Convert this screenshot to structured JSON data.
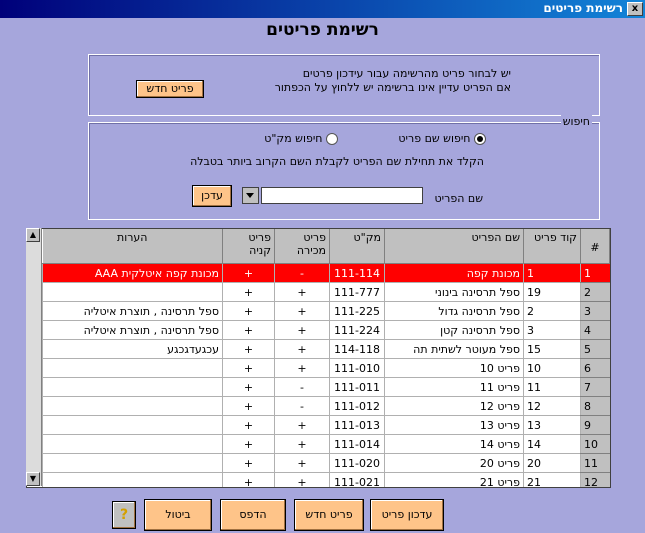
{
  "window": {
    "title": "רשימת פריטים",
    "close_glyph": "x"
  },
  "heading": "רשימת פריטים",
  "info": {
    "line1": "יש לבחור פריט מהרשימה עבור עידכון פרטים",
    "line2": "אם הפריט עדיין אינו ברשימה יש ללחוץ על הכפתור",
    "new_item_button": "פריט חדש"
  },
  "search": {
    "legend": "חיפוש",
    "option_name": "חיפוש שם פריט",
    "option_code": "חיפוש מק\"ט",
    "selected": "option_name",
    "hint": "הקלד את תחילת שם  הפריט לקבלת השם הקרוב ביותר בטבלה",
    "field_label": "שם הפריט",
    "field_value": "",
    "update_button": "עדכן"
  },
  "table": {
    "headers": [
      "#",
      "קוד פריט",
      "שם הפריט",
      "מק\"ט",
      "פריט מכירה",
      "פריט קניה",
      "הערות"
    ],
    "rows": [
      {
        "n": "1",
        "code": "1",
        "name": "מכונת קפה",
        "sku": "111-114",
        "sale": "-",
        "buy": "+",
        "notes": "מכונת קפה איטלקית AAA",
        "selected": true
      },
      {
        "n": "2",
        "code": "19",
        "name": "ספל תרסינה בינוני",
        "sku": "111-777",
        "sale": "+",
        "buy": "+",
        "notes": ""
      },
      {
        "n": "3",
        "code": "2",
        "name": "ספל תרסינה גדול",
        "sku": "111-225",
        "sale": "+",
        "buy": "+",
        "notes": "ספל תרסינה , תוצרת איטליה"
      },
      {
        "n": "4",
        "code": "3",
        "name": "ספל תרסינה קטן",
        "sku": "111-224",
        "sale": "+",
        "buy": "+",
        "notes": "ספל תרסינה , תוצרת איטליה"
      },
      {
        "n": "5",
        "code": "15",
        "name": "ספל מעוטר לשתית תה",
        "sku": "114-118",
        "sale": "+",
        "buy": "+",
        "notes": "עכגעדגכגע"
      },
      {
        "n": "6",
        "code": "10",
        "name": "פריט 10",
        "sku": "111-010",
        "sale": "+",
        "buy": "+",
        "notes": ""
      },
      {
        "n": "7",
        "code": "11",
        "name": "פריט 11",
        "sku": "111-011",
        "sale": "-",
        "buy": "+",
        "notes": ""
      },
      {
        "n": "8",
        "code": "12",
        "name": "פריט 12",
        "sku": "111-012",
        "sale": "-",
        "buy": "+",
        "notes": ""
      },
      {
        "n": "9",
        "code": "13",
        "name": "פריט 13",
        "sku": "111-013",
        "sale": "+",
        "buy": "+",
        "notes": ""
      },
      {
        "n": "10",
        "code": "14",
        "name": "פריט 14",
        "sku": "111-014",
        "sale": "+",
        "buy": "+",
        "notes": ""
      },
      {
        "n": "11",
        "code": "20",
        "name": "פריט 20",
        "sku": "111-020",
        "sale": "+",
        "buy": "+",
        "notes": ""
      },
      {
        "n": "12",
        "code": "21",
        "name": "פריט 21",
        "sku": "111-021",
        "sale": "+",
        "buy": "+",
        "notes": ""
      }
    ]
  },
  "footer": {
    "update_item": "עדכון פריט",
    "new_item": "פריט חדש",
    "print": "הדפס",
    "cancel": "ביטול",
    "help_glyph": "?"
  },
  "colors": {
    "background": "#a6a6dc",
    "button": "#fec489",
    "selected_row": "#ff0000"
  }
}
